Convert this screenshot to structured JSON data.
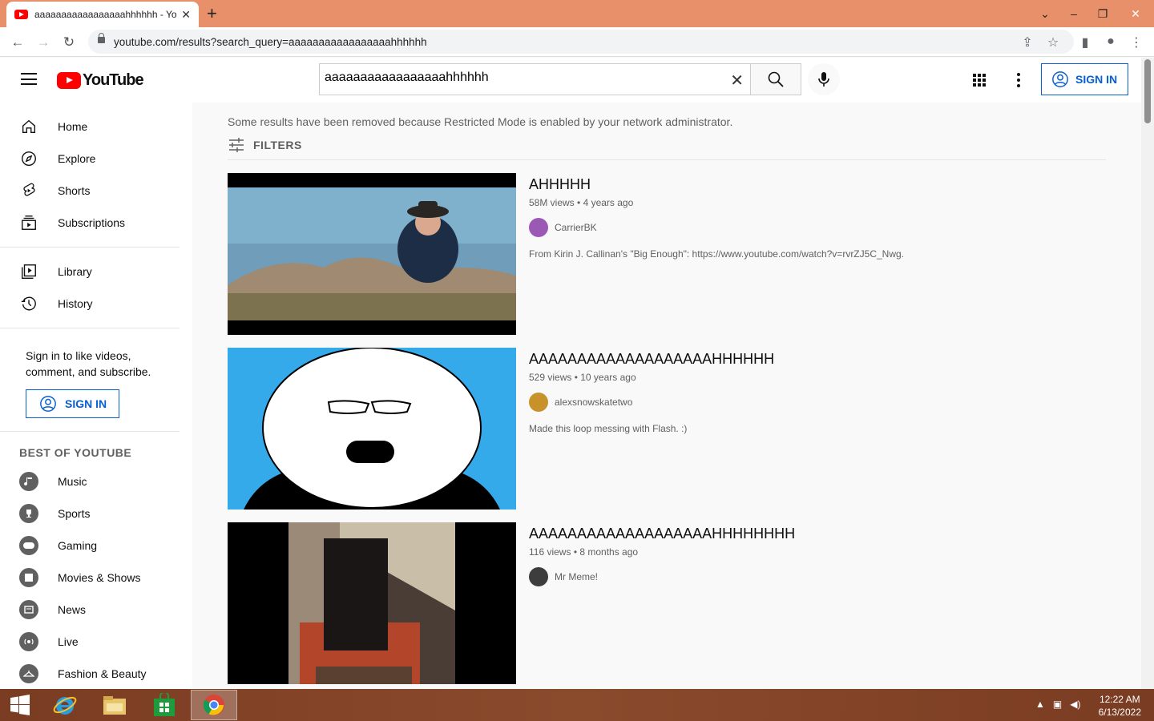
{
  "browser": {
    "tab_title": "aaaaaaaaaaaaaaaaahhhhhh - YouTube",
    "url": "youtube.com/results?search_query=aaaaaaaaaaaaaaaaahhhhhh"
  },
  "header": {
    "logo_text": "YouTube",
    "search_value": "aaaaaaaaaaaaaaaaahhhhhh",
    "sign_in": "SIGN IN"
  },
  "sidebar": {
    "main_items": [
      {
        "label": "Home",
        "icon": "home-icon"
      },
      {
        "label": "Explore",
        "icon": "compass-icon"
      },
      {
        "label": "Shorts",
        "icon": "shorts-icon"
      },
      {
        "label": "Subscriptions",
        "icon": "subscriptions-icon"
      }
    ],
    "lib_items": [
      {
        "label": "Library",
        "icon": "library-icon"
      },
      {
        "label": "History",
        "icon": "history-icon"
      }
    ],
    "signin_text": "Sign in to like videos, comment, and subscribe.",
    "signin_button": "SIGN IN",
    "best_of_heading": "BEST OF YOUTUBE",
    "best_items": [
      {
        "label": "Music",
        "icon": "music-icon"
      },
      {
        "label": "Sports",
        "icon": "trophy-icon"
      },
      {
        "label": "Gaming",
        "icon": "gaming-icon"
      },
      {
        "label": "Movies & Shows",
        "icon": "film-icon"
      },
      {
        "label": "News",
        "icon": "news-icon"
      },
      {
        "label": "Live",
        "icon": "live-icon"
      },
      {
        "label": "Fashion & Beauty",
        "icon": "hanger-icon"
      }
    ]
  },
  "results": {
    "notice": "Some results have been removed because Restricted Mode is enabled by your network administrator.",
    "filters_label": "FILTERS",
    "items": [
      {
        "title": "AHHHHH",
        "views": "58M views",
        "age": "4 years ago",
        "channel": "CarrierBK",
        "description": "From Kirin J. Callinan's \"Big Enough\": https://www.youtube.com/watch?v=rvrZJ5C_Nwg."
      },
      {
        "title": "AAAAAAAAAAAAAAAAAAAHHHHHH",
        "views": "529 views",
        "age": "10 years ago",
        "channel": "alexsnowskatetwo",
        "description": "Made this loop messing with Flash. :)"
      },
      {
        "title": "AAAAAAAAAAAAAAAAAAAHHHHHHHH",
        "views": "116 views",
        "age": "8 months ago",
        "channel": "Mr Meme!",
        "description": ""
      }
    ]
  },
  "taskbar": {
    "time": "12:22 AM",
    "date": "6/13/2022"
  },
  "colors": {
    "accent": "#065fd4",
    "brand": "#ff0000"
  }
}
